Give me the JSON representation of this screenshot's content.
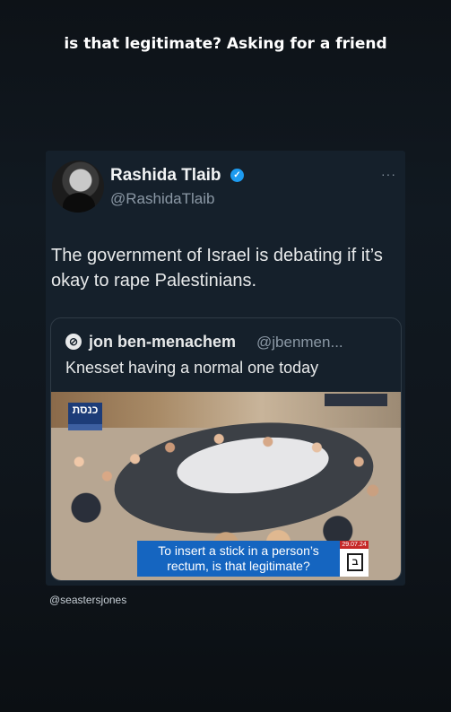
{
  "caption": "is that legitimate? Asking for a friend",
  "tweet": {
    "name": "Rashida Tlaib",
    "handle": "@RashidaTlaib",
    "more": "···",
    "text": "The government of Israel is debating if it’s okay to rape Palestinians.",
    "verified_color": "#1d9bf0"
  },
  "quote": {
    "name": "jon ben-menachem",
    "handle": "@jbenmen...",
    "text": "Knesset having a normal one today",
    "video": {
      "channel_logo": "כנסת",
      "subtitle_line1": "To insert a stick in a person’s",
      "subtitle_line2": "rectum, is that legitimate?",
      "date": "29.07.24"
    }
  },
  "footer_handle": "@seastersjones"
}
